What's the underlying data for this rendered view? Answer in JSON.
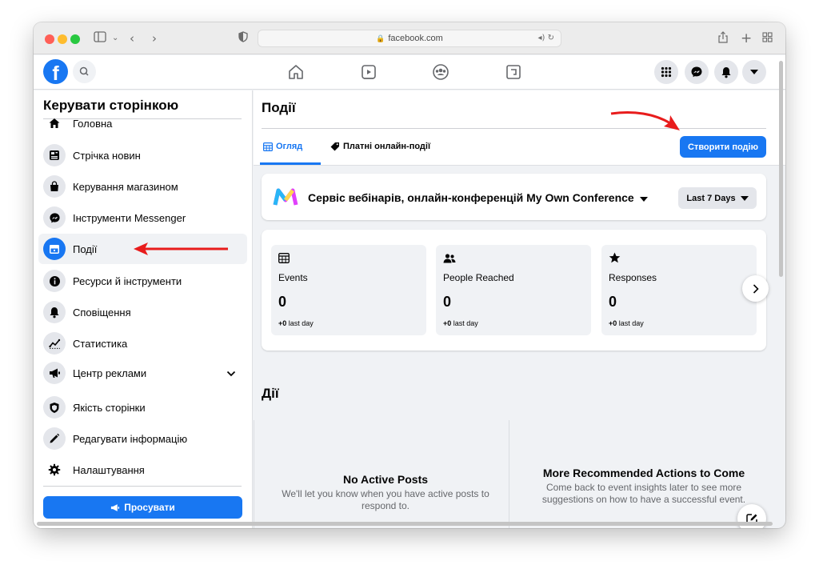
{
  "browser": {
    "url": "facebook.com"
  },
  "sidebar": {
    "title": "Керувати сторінкою",
    "items": [
      {
        "label": "Головна",
        "icon": "home-icon"
      },
      {
        "label": "Стрічка новин",
        "icon": "news-feed-icon"
      },
      {
        "label": "Керування магазином",
        "icon": "shop-bag-icon"
      },
      {
        "label": "Інструменти Messenger",
        "icon": "messenger-icon"
      },
      {
        "label": "Події",
        "icon": "calendar-icon",
        "active": true
      },
      {
        "label": "Ресурси й інструменти",
        "icon": "info-icon"
      },
      {
        "label": "Сповіщення",
        "icon": "bell-icon"
      },
      {
        "label": "Статистика",
        "icon": "chart-line-icon"
      },
      {
        "label": "Центр реклами",
        "icon": "megaphone-icon"
      },
      {
        "label": "Якість сторінки",
        "icon": "shield-icon"
      },
      {
        "label": "Редагувати інформацію",
        "icon": "pencil-icon"
      },
      {
        "label": "Налаштування",
        "icon": "gear-icon"
      }
    ],
    "promote_label": "Просувати"
  },
  "main": {
    "title": "Події",
    "tabs": [
      {
        "label": "Огляд",
        "active": true
      },
      {
        "label": "Платні онлайн-події",
        "active": false
      }
    ],
    "create_button": "Створити подію",
    "page_name": "Сервіс вебінарів, онлайн-конференцій My Own Conference",
    "date_range": "Last 7 Days",
    "stats": [
      {
        "label": "Events",
        "value": "0",
        "delta": "+0",
        "delta_suffix": " last day",
        "icon": "calendar-grid-icon"
      },
      {
        "label": "People Reached",
        "value": "0",
        "delta": "+0",
        "delta_suffix": " last day",
        "icon": "people-icon"
      },
      {
        "label": "Responses",
        "value": "0",
        "delta": "+0",
        "delta_suffix": " last day",
        "icon": "star-icon"
      }
    ],
    "actions_title": "Дії",
    "no_posts_title": "No Active Posts",
    "no_posts_text": "We'll let you know when you have active posts to respond to.",
    "recommended_title": "More Recommended Actions to Come",
    "recommended_text": "Come back to event insights later to see more suggestions on how to have a successful event."
  },
  "colors": {
    "brand": "#1877f2",
    "annotation_arrow": "#e81c1c",
    "page_bg": "#f0f2f5"
  }
}
